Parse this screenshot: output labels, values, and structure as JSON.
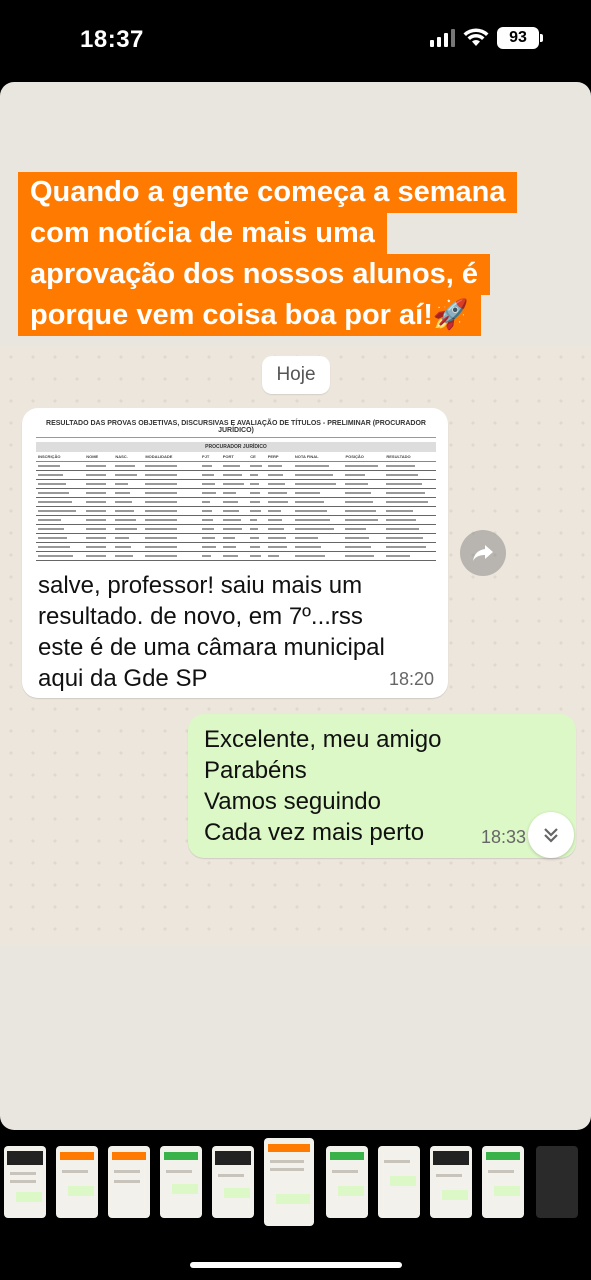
{
  "status": {
    "time": "18:37",
    "battery": "93"
  },
  "caption": {
    "lines": [
      "Quando a gente começa a semana",
      "com notícia de mais uma",
      "aprovação dos nossos alunos, é",
      "porque vem coisa boa por aí!🚀"
    ]
  },
  "chat": {
    "date_chip": "Hoje",
    "incoming": {
      "document": {
        "title": "RESULTADO DAS PROVAS OBJETIVAS, DISCURSIVAS E AVALIAÇÃO DE TÍTULOS - PRELIMINAR (PROCURADOR JURÍDICO)",
        "subtitle": "PROCURADOR JURÍDICO",
        "columns": [
          "INSCRIÇÃO",
          "NOME",
          "NASC.",
          "MODALIDADE",
          "PJT",
          "PORT",
          "CE",
          "PERP",
          "NOTA FINAL",
          "POSIÇÃO",
          "RESULTADO"
        ]
      },
      "text": "salve, professor! saiu mais um\nresultado. de novo, em 7º...rss\neste é de uma câmara municipal\naqui da Gde SP",
      "time": "18:20"
    },
    "outgoing": {
      "text": "Excelente, meu amigo\nParabéns\nVamos seguindo\nCada vez mais perto",
      "time": "18:33"
    }
  },
  "icons": {
    "forward": "forward-arrow-icon",
    "scroll_down": "double-chevron-down-icon",
    "signal": "cellular-signal-icon",
    "wifi": "wifi-icon"
  },
  "colors": {
    "caption_bg": "#ff7a00",
    "outgoing_bubble": "#dcf8c6",
    "incoming_bubble": "#ffffff"
  }
}
